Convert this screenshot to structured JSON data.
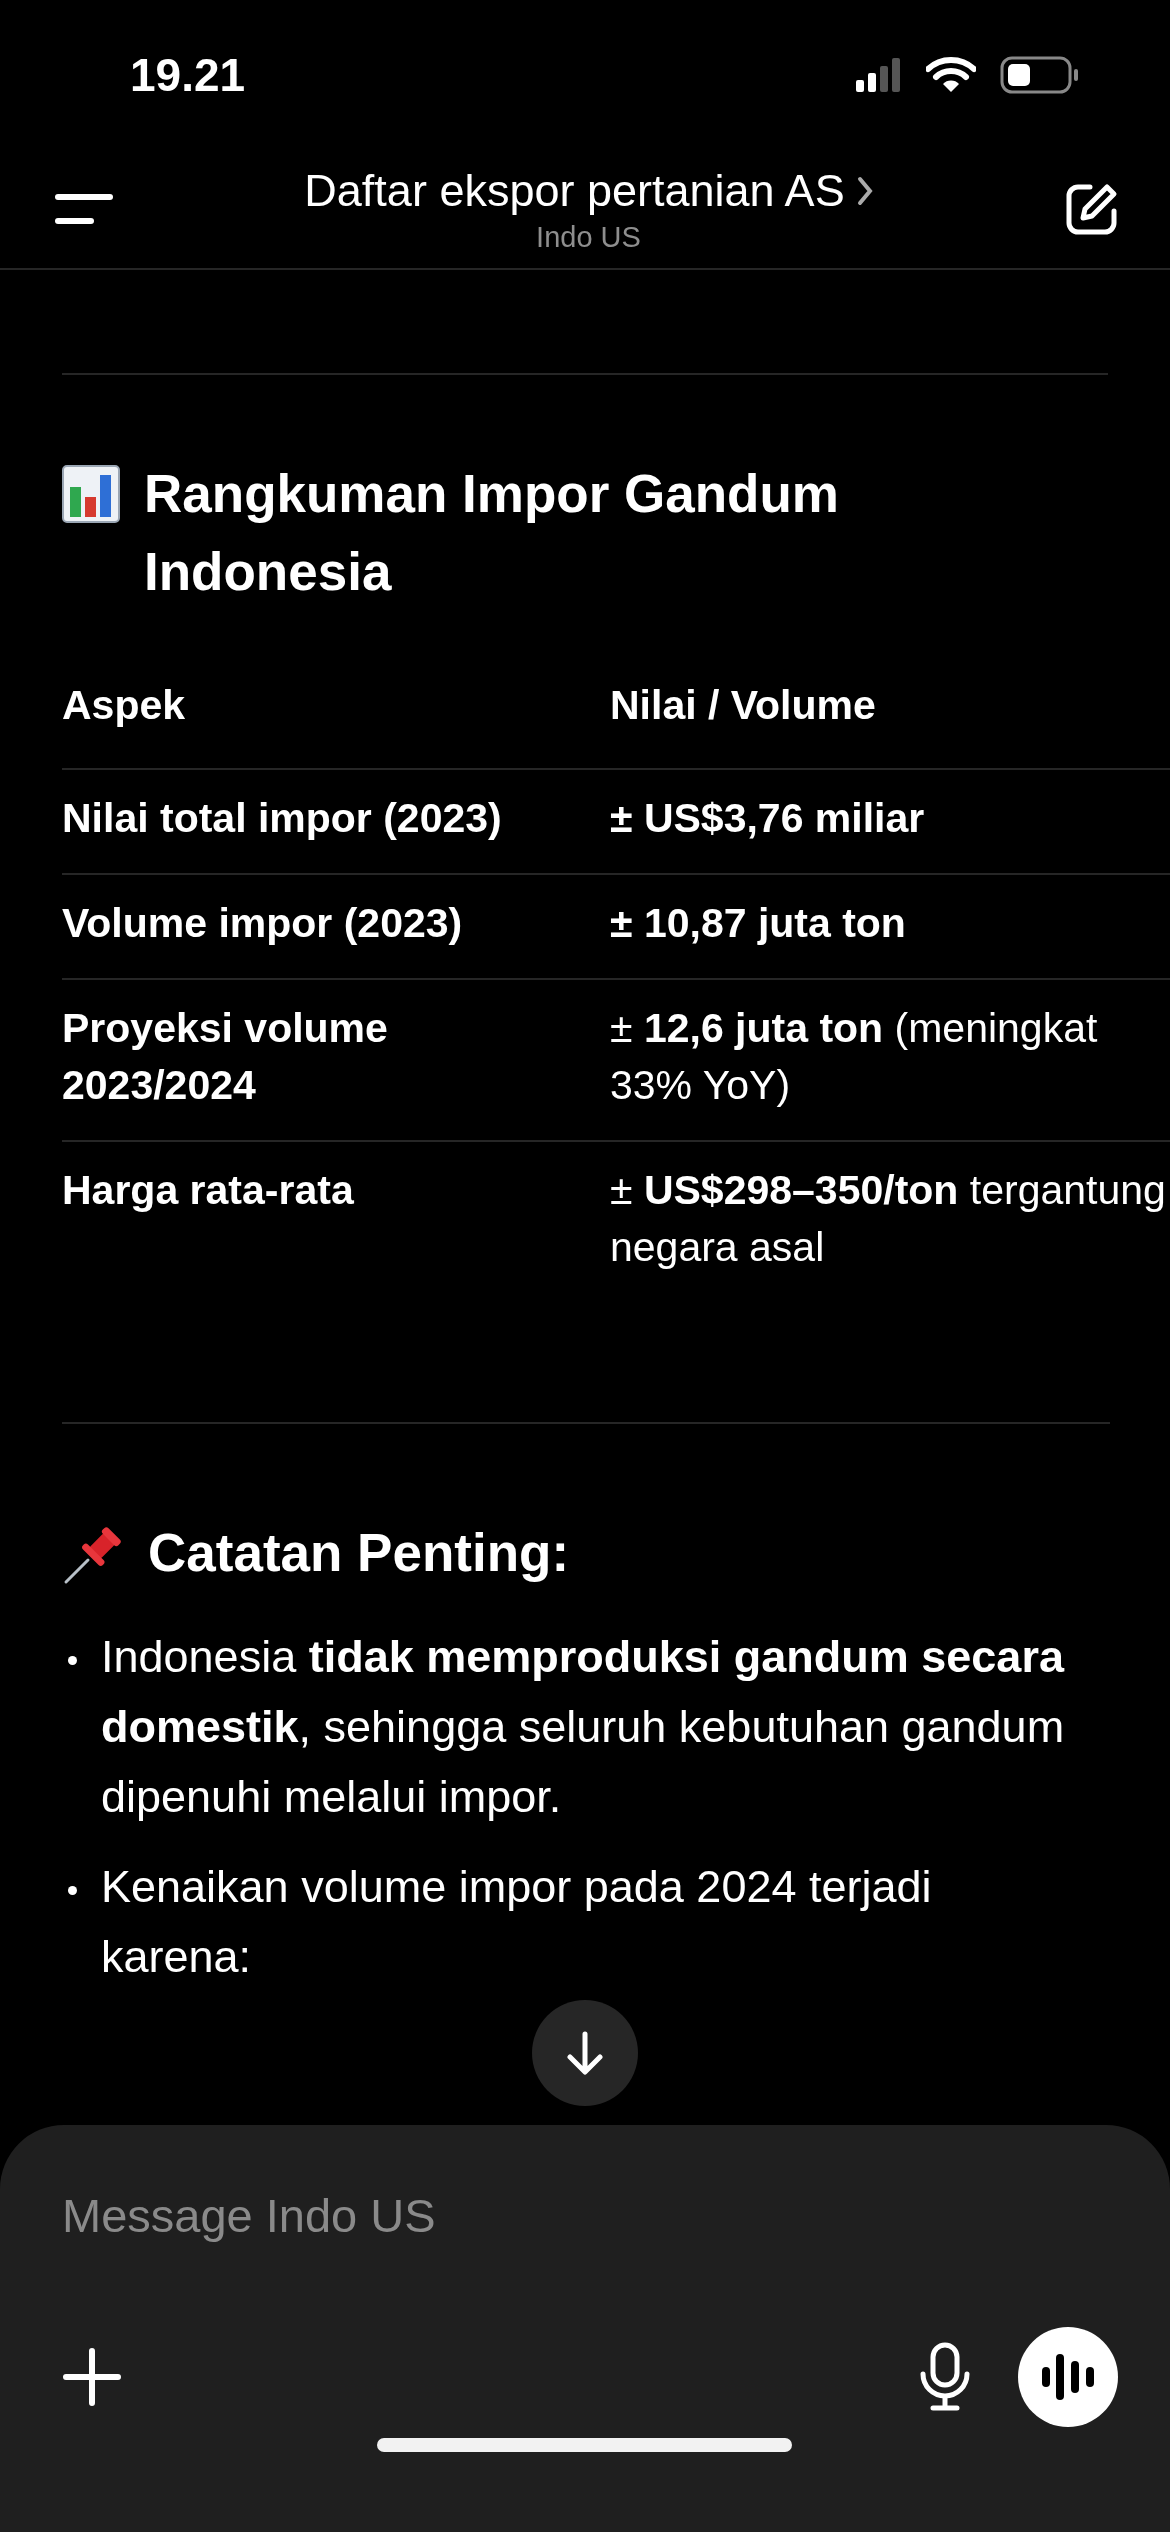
{
  "status_bar": {
    "time": "19.21"
  },
  "header": {
    "title": "Daftar ekspor pertanian AS",
    "subtitle": "Indo US"
  },
  "summary": {
    "title": "Rangkuman Impor Gandum Indonesia",
    "table": {
      "columns": [
        "Aspek",
        "Nilai / Volume"
      ],
      "rows": [
        {
          "aspect": "Nilai total impor (2023)",
          "value": "± US$3,76 miliar",
          "emphasis": true
        },
        {
          "aspect": "Volume impor (2023)",
          "value": "± 10,87 juta ton",
          "emphasis": true
        },
        {
          "aspect": "Proyeksi volume 2023/2024",
          "value": "± **12,6 juta ton** (meningkat 33% YoY)",
          "emphasis": false
        },
        {
          "aspect": "Harga rata-rata",
          "value": "± **US$298–350/ton** tergantung negara asal",
          "emphasis": false
        }
      ]
    }
  },
  "notes": {
    "title": "Catatan Penting:",
    "bullets": [
      "Indonesia **tidak memproduksi gandum secara domestik**, sehingga seluruh kebutuhan gandum dipenuhi melalui impor.",
      "Kenaikan volume impor pada 2024 terjadi karena:"
    ]
  },
  "composer": {
    "placeholder": "Message Indo US"
  }
}
